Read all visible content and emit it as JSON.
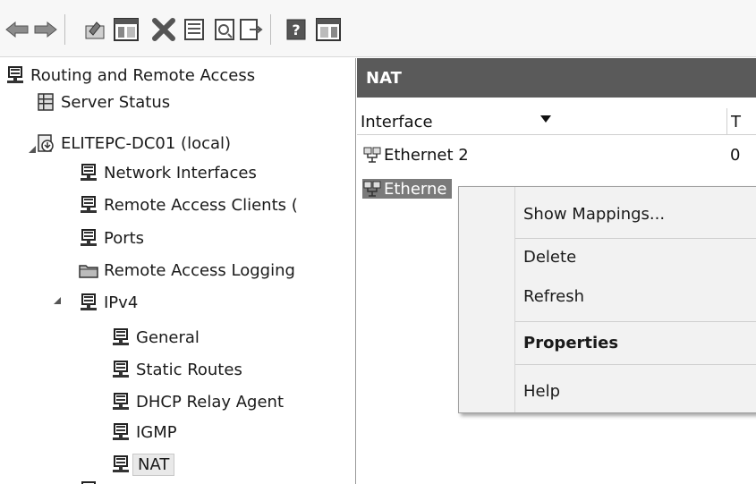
{
  "toolbar": {
    "buttons": [
      {
        "name": "back-icon"
      },
      {
        "name": "forward-icon"
      },
      {
        "name": "up-folder-icon"
      },
      {
        "name": "show-hide-tree-icon"
      },
      {
        "name": "delete-icon"
      },
      {
        "name": "properties-icon"
      },
      {
        "name": "refresh-icon"
      },
      {
        "name": "export-list-icon"
      },
      {
        "name": "help-icon"
      },
      {
        "name": "show-hide-action-pane-icon"
      }
    ]
  },
  "tree": {
    "root": "Routing and Remote Access",
    "server_status": "Server Status",
    "server": "ELITEPC-DC01 (local)",
    "network_interfaces": "Network Interfaces",
    "remote_access_clients": "Remote Access Clients (",
    "ports": "Ports",
    "remote_access_logging": "Remote Access Logging",
    "ipv4": "IPv4",
    "general": "General",
    "static_routes": "Static Routes",
    "dhcp_relay_agent": "DHCP Relay Agent",
    "igmp": "IGMP",
    "nat": "NAT"
  },
  "details": {
    "title": "NAT",
    "columns": [
      "Interface",
      "T"
    ],
    "rows": [
      {
        "interface": "Ethernet 2",
        "t": "0"
      },
      {
        "interface": "Etherne",
        "t": ""
      }
    ]
  },
  "context_menu": {
    "show_mappings": "Show Mappings...",
    "delete": "Delete",
    "refresh": "Refresh",
    "properties": "Properties",
    "help": "Help"
  },
  "colors": {
    "header_bg": "#5a5a5a",
    "selection_bg": "#7a7a7a",
    "menu_bg": "#f2f2f2"
  }
}
